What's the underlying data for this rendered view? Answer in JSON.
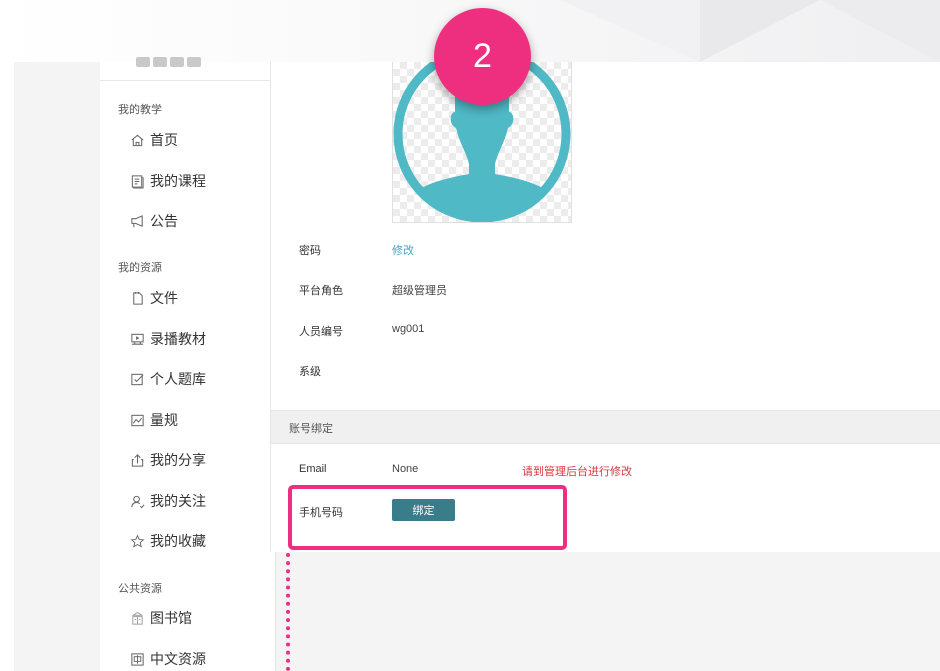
{
  "annotation": {
    "step_number": "2",
    "accent_color": "#ee2f7f"
  },
  "sidebar": {
    "sections": [
      {
        "title": "我的教学",
        "items": [
          {
            "label": "首页",
            "icon": "home-icon"
          },
          {
            "label": "我的课程",
            "icon": "course-icon"
          },
          {
            "label": "公告",
            "icon": "megaphone-icon"
          }
        ]
      },
      {
        "title": "我的资源",
        "items": [
          {
            "label": "文件",
            "icon": "file-icon"
          },
          {
            "label": "录播教材",
            "icon": "recording-icon"
          },
          {
            "label": "个人题库",
            "icon": "question-bank-icon"
          },
          {
            "label": "量规",
            "icon": "rubric-icon"
          },
          {
            "label": "我的分享",
            "icon": "share-icon"
          },
          {
            "label": "我的关注",
            "icon": "follow-icon"
          },
          {
            "label": "我的收藏",
            "icon": "star-icon"
          }
        ]
      },
      {
        "title": "公共资源",
        "items": [
          {
            "label": "图书馆",
            "icon": "library-icon"
          },
          {
            "label": "中文资源",
            "icon": "chinese-resource-icon"
          }
        ]
      }
    ]
  },
  "profile": {
    "avatar_icon": "user-avatar-icon",
    "avatar_color": "#4fb9c5",
    "fields": [
      {
        "label": "密码",
        "value": "修改"
      },
      {
        "label": "平台角色",
        "value": "超级管理员"
      },
      {
        "label": "人员编号",
        "value": "wg001"
      },
      {
        "label": "系级",
        "value": ""
      }
    ]
  },
  "binding": {
    "header": "账号绑定",
    "email_label": "Email",
    "email_value": "None",
    "email_notice": "请到管理后台进行修改",
    "phone_label": "手机号码",
    "bind_button": "绑定",
    "button_color": "#3a7d8a",
    "notice_color": "#d9363e"
  }
}
